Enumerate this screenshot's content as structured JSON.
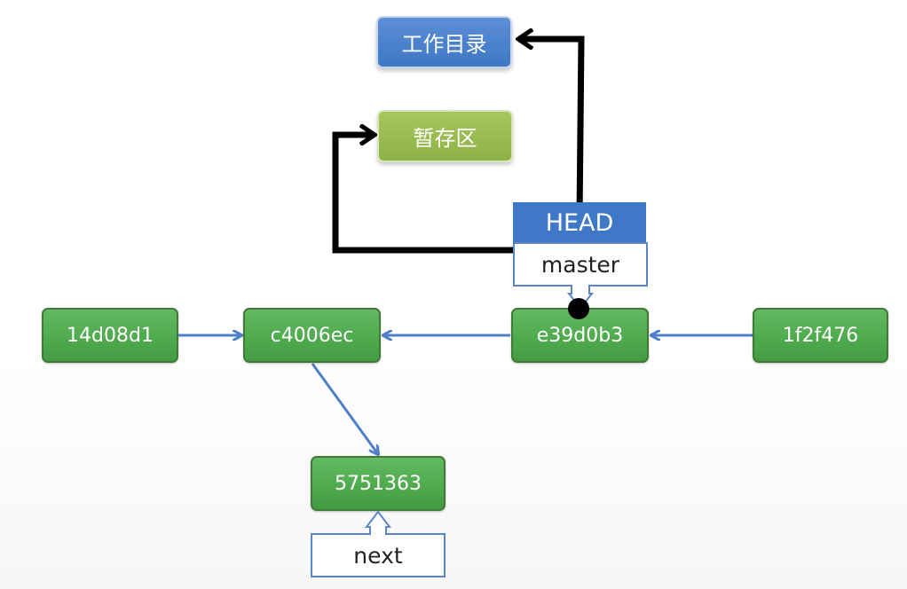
{
  "areas": {
    "working_directory": "工作目录",
    "staging_area": "暂存区"
  },
  "refs": {
    "head": "HEAD",
    "master": "master",
    "next": "next"
  },
  "commits": {
    "c1": "14d08d1",
    "c2": "c4006ec",
    "c3": "e39d0b3",
    "c4": "1f2f476",
    "c5": "5751363"
  },
  "colors": {
    "commit_green": "#4ea94c",
    "workdir_blue": "#3f77c4",
    "stage_green": "#8db145",
    "link_blue": "#4f80c7",
    "pointer_black": "#000000"
  }
}
